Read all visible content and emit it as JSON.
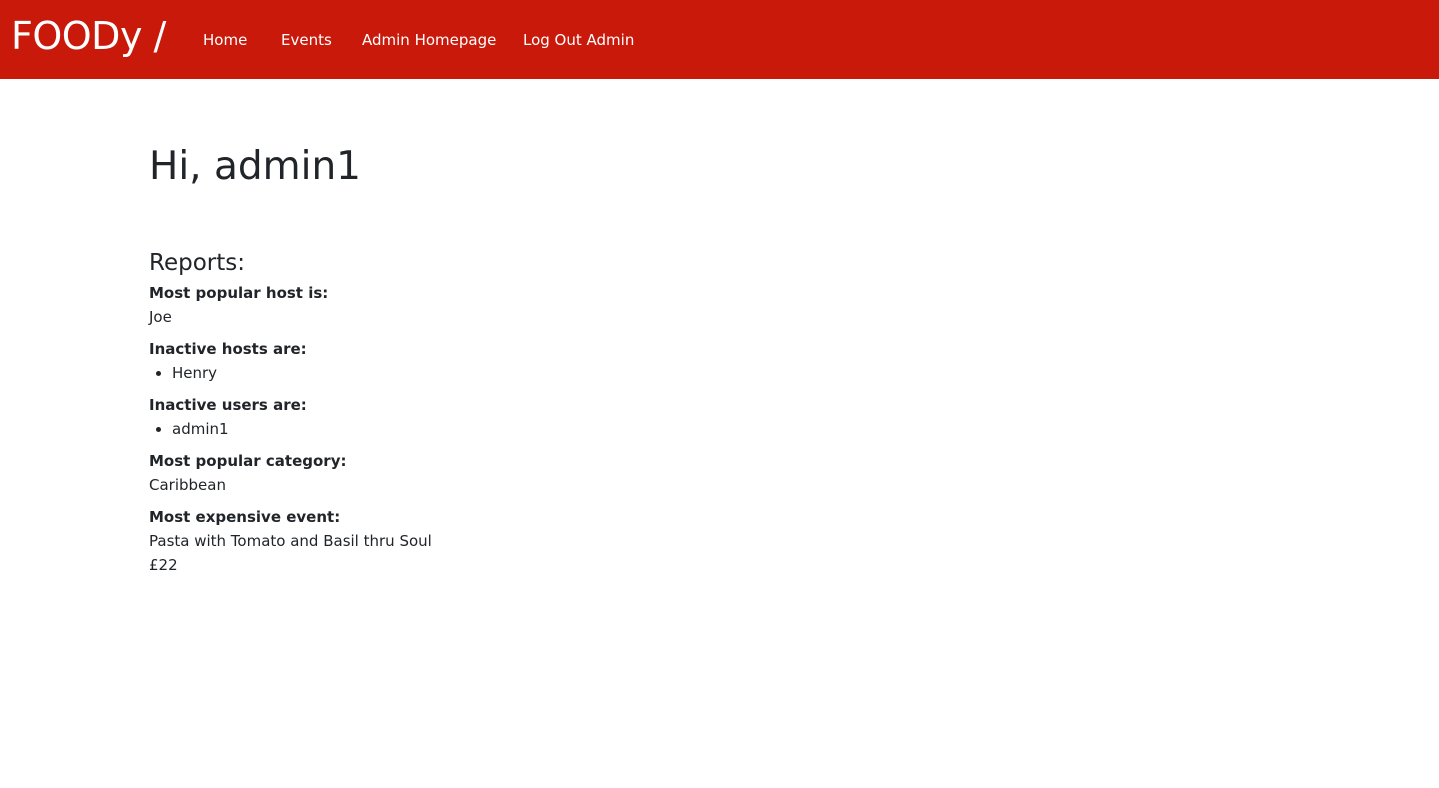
{
  "navbar": {
    "brand": "FOODy /",
    "links": {
      "home": "Home",
      "events": "Events",
      "admin_homepage": "Admin Homepage",
      "logout": "Log Out Admin"
    },
    "background_color": "#c8190b"
  },
  "main": {
    "greeting_prefix": "Hi,",
    "username": "admin1",
    "reports_heading": "Reports:",
    "popular_host": {
      "label": "Most popular host is:",
      "value": "Joe"
    },
    "inactive_hosts": {
      "label": "Inactive hosts are:",
      "items": [
        "Henry"
      ]
    },
    "inactive_users": {
      "label": "Inactive users are:",
      "items": [
        "admin1"
      ]
    },
    "popular_category": {
      "label": "Most popular category:",
      "value": "Caribbean"
    },
    "expensive_event": {
      "label": "Most expensive event:",
      "name": "Pasta with Tomato and Basil thru Soul",
      "price": "£22"
    }
  }
}
